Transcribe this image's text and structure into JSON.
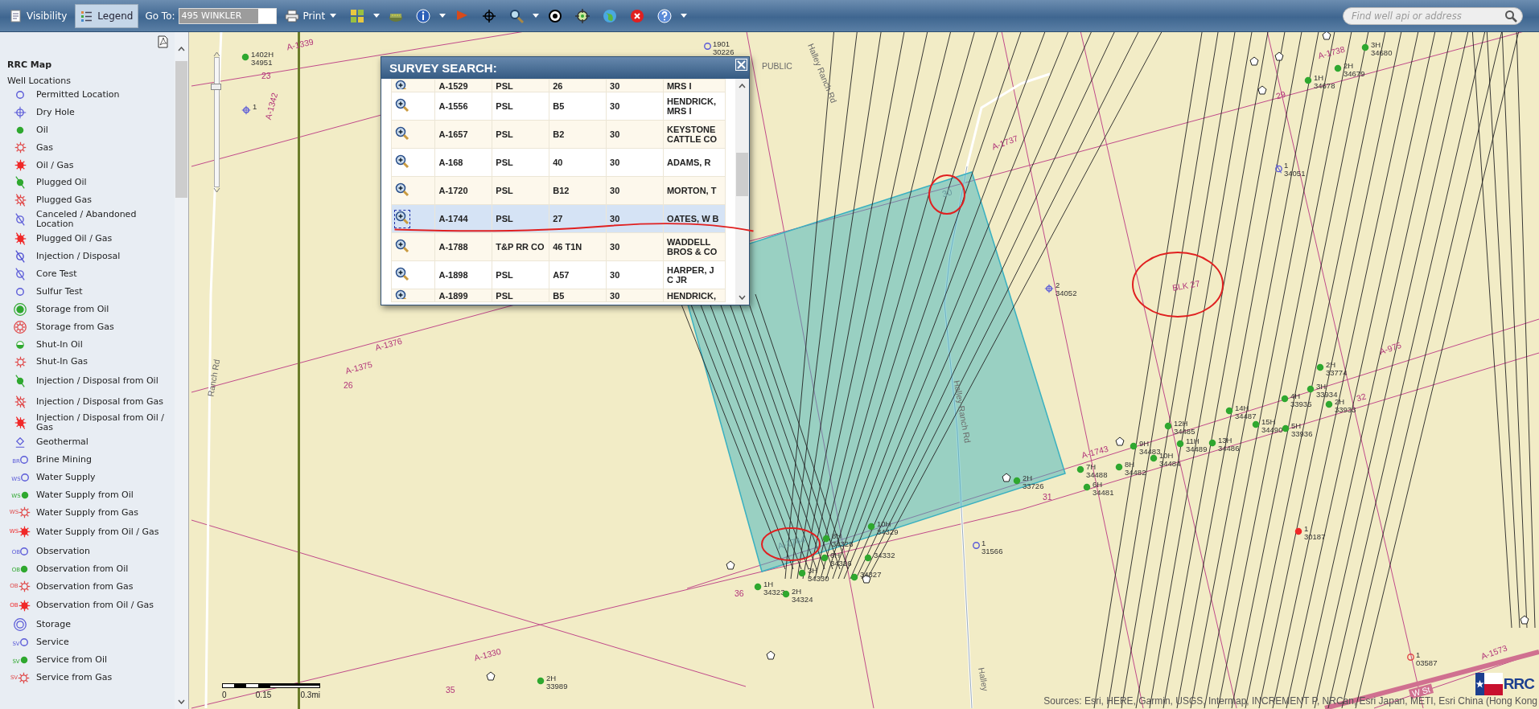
{
  "toolbar": {
    "buttons": [
      {
        "kind": "visibility",
        "label": "Visibility",
        "selected": false
      },
      {
        "kind": "legend",
        "label": "Legend",
        "selected": true
      }
    ],
    "goto": {
      "label": "Go To:",
      "value": "495 WINKLER"
    },
    "print": {
      "label": "Print"
    },
    "search": {
      "placeholder": "Find well api or address"
    }
  },
  "sidebar": {
    "title": "RRC Map",
    "section": "Well Locations",
    "items": [
      {
        "label": "Permitted Location",
        "kind": "permitted"
      },
      {
        "label": "Dry Hole",
        "kind": "dryhole"
      },
      {
        "label": "Oil",
        "kind": "oil"
      },
      {
        "label": "Gas",
        "kind": "gas"
      },
      {
        "label": "Oil / Gas",
        "kind": "oilgas"
      },
      {
        "label": "Plugged Oil",
        "kind": "pluggedoil"
      },
      {
        "label": "Plugged Gas",
        "kind": "pluggedgas"
      },
      {
        "label": "Canceled / Abandoned Location",
        "kind": "canceled"
      },
      {
        "label": "Plugged Oil / Gas",
        "kind": "pluggedoilgas"
      },
      {
        "label": "Injection / Disposal",
        "kind": "injection"
      },
      {
        "label": "Core Test",
        "kind": "core"
      },
      {
        "label": "Sulfur Test",
        "kind": "sulfur"
      },
      {
        "label": "Storage from Oil",
        "kind": "storageoil"
      },
      {
        "label": "Storage from Gas",
        "kind": "storagegas"
      },
      {
        "label": "Shut-In Oil",
        "kind": "shutinoil"
      },
      {
        "label": "Shut-In Gas",
        "kind": "shutingas"
      },
      {
        "label": "Injection / Disposal from Oil",
        "kind": "injoil"
      },
      {
        "label": "Injection / Disposal from Gas",
        "kind": "injgas"
      },
      {
        "label": "Injection / Disposal from Oil / Gas",
        "kind": "injoilgas"
      },
      {
        "label": "Geothermal",
        "kind": "geothermal"
      },
      {
        "label": "Brine Mining",
        "kind": "permitted",
        "prefix": "BR"
      },
      {
        "label": "Water Supply",
        "kind": "permitted",
        "prefix": "WS"
      },
      {
        "label": "Water Supply from Oil",
        "kind": "oil",
        "prefix": "WS"
      },
      {
        "label": "Water Supply from Gas",
        "kind": "gas",
        "prefix": "WS"
      },
      {
        "label": "Water Supply from Oil / Gas",
        "kind": "oilgas",
        "prefix": "WS"
      },
      {
        "label": "Observation",
        "kind": "permitted",
        "prefix": "OB"
      },
      {
        "label": "Observation from Oil",
        "kind": "oil",
        "prefix": "OB"
      },
      {
        "label": "Observation from Gas",
        "kind": "gas",
        "prefix": "OB"
      },
      {
        "label": "Observation from Oil / Gas",
        "kind": "oilgas",
        "prefix": "OB"
      },
      {
        "label": "Storage",
        "kind": "storage"
      },
      {
        "label": "Service",
        "kind": "permitted",
        "prefix": "SV"
      },
      {
        "label": "Service from Oil",
        "kind": "oil",
        "prefix": "SV"
      },
      {
        "label": "Service from Gas",
        "kind": "gas",
        "prefix": "SV"
      }
    ]
  },
  "map": {
    "zoom_slider": {
      "level": 0.8
    },
    "labels": [
      {
        "text": "A-1339",
        "kind": "survey"
      },
      {
        "text": "23",
        "kind": "survey"
      },
      {
        "text": "A-1342",
        "kind": "survey"
      },
      {
        "text": "PUBLIC",
        "kind": "road"
      },
      {
        "text": "Halley Ranch Rd",
        "kind": "road"
      },
      {
        "text": "A-1738",
        "kind": "survey"
      },
      {
        "text": "29",
        "kind": "survey"
      },
      {
        "text": "A-1737",
        "kind": "survey"
      },
      {
        "text": "30",
        "kind": "section"
      },
      {
        "text": "BLK 27",
        "kind": "survey"
      },
      {
        "text": "A-975",
        "kind": "survey"
      },
      {
        "text": "A-1376",
        "kind": "survey"
      },
      {
        "text": "A-1375",
        "kind": "survey"
      },
      {
        "text": "26",
        "kind": "survey"
      },
      {
        "text": "Ranch Rd",
        "kind": "road"
      },
      {
        "text": "Halley Ranch Rd",
        "kind": "road"
      },
      {
        "text": "32",
        "kind": "survey"
      },
      {
        "text": "A-1743",
        "kind": "survey"
      },
      {
        "text": "31",
        "kind": "survey"
      },
      {
        "text": "A-1744",
        "kind": "section"
      },
      {
        "text": "36",
        "kind": "survey"
      },
      {
        "text": "A-1330",
        "kind": "survey"
      },
      {
        "text": "35",
        "kind": "survey"
      },
      {
        "text": "Halley",
        "kind": "road"
      },
      {
        "text": "A-1573",
        "kind": "survey"
      },
      {
        "text": "W St",
        "kind": "highway"
      }
    ],
    "wells": [
      {
        "label": "1402H",
        "number": "34951",
        "kind": "oil"
      },
      {
        "label": "1901",
        "number": "30226",
        "kind": "permitted"
      },
      {
        "label": "3H",
        "number": "34680",
        "kind": "oil"
      },
      {
        "label": "2H",
        "number": "34679",
        "kind": "oil"
      },
      {
        "label": "1H",
        "number": "34678",
        "kind": "oil"
      },
      {
        "label": "1",
        "number": "34051",
        "kind": "canceled"
      },
      {
        "label": "2",
        "number": "34052",
        "kind": "dry"
      },
      {
        "label": "1",
        "kind": "dry"
      },
      {
        "label": "2H",
        "number": "33774",
        "kind": "oil"
      },
      {
        "label": "3H",
        "number": "33934",
        "kind": "oil"
      },
      {
        "label": "4H",
        "number": "33935",
        "kind": "oil"
      },
      {
        "label": "2H",
        "number": "33933",
        "kind": "oil"
      },
      {
        "label": "14H",
        "number": "34487",
        "kind": "oil"
      },
      {
        "label": "12H",
        "number": "34485",
        "kind": "oil"
      },
      {
        "label": "15H",
        "number": "34490",
        "kind": "oil"
      },
      {
        "label": "5H",
        "number": "33936",
        "kind": "oil"
      },
      {
        "label": "9H",
        "number": "34483",
        "kind": "oil"
      },
      {
        "label": "11H",
        "number": "34489",
        "kind": "oil"
      },
      {
        "label": "13H",
        "number": "34486",
        "kind": "oil"
      },
      {
        "label": "10H",
        "number": "34484",
        "kind": "oil"
      },
      {
        "label": "7H",
        "number": "34488",
        "kind": "oil"
      },
      {
        "label": "8H",
        "number": "34482",
        "kind": "oil"
      },
      {
        "label": "6H",
        "number": "34481",
        "kind": "oil"
      },
      {
        "label": "2H",
        "number": "33726",
        "kind": "oil"
      },
      {
        "label": "10H",
        "number": "34329",
        "kind": "oil"
      },
      {
        "label": "8H",
        "number": "34328",
        "kind": "oil"
      },
      {
        "label": "1",
        "number": "31566",
        "kind": "permitted"
      },
      {
        "label": "1",
        "number": "30187",
        "kind": "gas"
      },
      {
        "label": "6H",
        "number": "34326",
        "kind": "oil"
      },
      {
        "number": "34332",
        "kind": "oil"
      },
      {
        "label": "3H",
        "number": "34330",
        "kind": "oil"
      },
      {
        "label": "1H",
        "number": "34323",
        "kind": "oil"
      },
      {
        "label": "2H",
        "number": "34324",
        "kind": "oil"
      },
      {
        "number": "34327",
        "kind": "oil"
      },
      {
        "label": "2H",
        "number": "33989",
        "kind": "oil"
      },
      {
        "label": "1",
        "number": "03587",
        "kind": "gaspermit"
      }
    ],
    "scale": {
      "ticks": [
        "0",
        "0.15",
        "0.3mi"
      ]
    },
    "attribution": "Sources: Esri, HERE, Garmin, USGS, Intermap, INCREMENT P, NRCan, Esri Japan, METI, Esri China (Hong Kong",
    "logo": {
      "text": "RRC"
    }
  },
  "dialog": {
    "title": "SURVEY SEARCH:",
    "rows": [
      {
        "abstract": "A-1529",
        "survey": "PSL",
        "block": "26",
        "county": "30",
        "name": "MRS I",
        "selected": false,
        "partial": true
      },
      {
        "abstract": "A-1556",
        "survey": "PSL",
        "block": "B5",
        "county": "30",
        "name": "HENDRICK, MRS I",
        "selected": false
      },
      {
        "abstract": "A-1657",
        "survey": "PSL",
        "block": "B2",
        "county": "30",
        "name": "KEYSTONE CATTLE CO",
        "selected": false
      },
      {
        "abstract": "A-168",
        "survey": "PSL",
        "block": "40",
        "county": "30",
        "name": "ADAMS, R",
        "selected": false
      },
      {
        "abstract": "A-1720",
        "survey": "PSL",
        "block": "B12",
        "county": "30",
        "name": "MORTON, T",
        "selected": false
      },
      {
        "abstract": "A-1744",
        "survey": "PSL",
        "block": "27",
        "county": "30",
        "name": "OATES, W B",
        "selected": true
      },
      {
        "abstract": "A-1788",
        "survey": "T&P RR CO",
        "block": "46 T1N",
        "county": "30",
        "name": "WADDELL BROS & CO",
        "selected": false
      },
      {
        "abstract": "A-1898",
        "survey": "PSL",
        "block": "A57",
        "county": "30",
        "name": "HARPER, J C JR",
        "selected": false
      },
      {
        "abstract": "A-1899",
        "survey": "PSL",
        "block": "B5",
        "county": "30",
        "name": "HENDRICK,",
        "selected": false,
        "partial": true
      }
    ]
  }
}
